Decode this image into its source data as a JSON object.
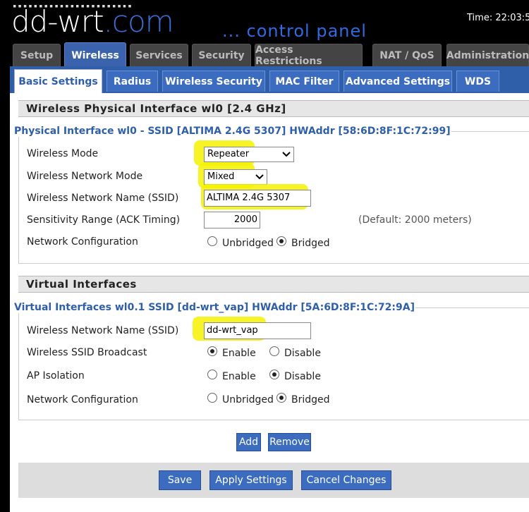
{
  "header": {
    "logo_text": "dd-wrt",
    "logo_suffix": ".com",
    "subtitle": "... control panel",
    "time": "Time: 22:03:5"
  },
  "main_tabs": [
    "Setup",
    "Wireless",
    "Services",
    "Security",
    "Access Restrictions",
    "NAT / QoS",
    "Administration"
  ],
  "sub_tabs": [
    "Basic Settings",
    "Radius",
    "Wireless Security",
    "MAC Filter",
    "Advanced Settings",
    "WDS"
  ],
  "physical": {
    "section_title": "Wireless Physical Interface wl0 [2.4 GHz]",
    "legend": "Physical Interface wl0 - SSID [ALTIMA 2.4G 5307] HWAddr [58:6D:8F:1C:72:99]",
    "wireless_mode": {
      "label": "Wireless Mode",
      "value": "Repeater"
    },
    "network_mode": {
      "label": "Wireless Network Mode",
      "value": "Mixed"
    },
    "ssid": {
      "label": "Wireless Network Name (SSID)",
      "value": "ALTIMA 2.4G 5307"
    },
    "sensitivity": {
      "label": "Sensitivity Range (ACK Timing)",
      "value": "2000",
      "hint": "(Default: 2000 meters)"
    },
    "netconfig": {
      "label": "Network Configuration",
      "options": [
        "Unbridged",
        "Bridged"
      ],
      "selected": "Bridged"
    }
  },
  "virtual": {
    "section_title": "Virtual Interfaces",
    "legend": "Virtual Interfaces wl0.1 SSID [dd-wrt_vap] HWAddr [5A:6D:8F:1C:72:9A]",
    "ssid": {
      "label": "Wireless Network Name (SSID)",
      "value": "dd-wrt_vap"
    },
    "broadcast": {
      "label": "Wireless SSID Broadcast",
      "options": [
        "Enable",
        "Disable"
      ],
      "selected": "Enable"
    },
    "ap_isolation": {
      "label": "AP Isolation",
      "options": [
        "Enable",
        "Disable"
      ],
      "selected": "Disable"
    },
    "netconfig": {
      "label": "Network Configuration",
      "options": [
        "Unbridged",
        "Bridged"
      ],
      "selected": "Bridged"
    },
    "add_label": "Add",
    "remove_label": "Remove"
  },
  "footer": {
    "save_label": "Save",
    "apply_label": "Apply Settings",
    "cancel_label": "Cancel Changes"
  },
  "colors": {
    "accent": "#3b63ad",
    "highlight": "#f5f200",
    "legend_text": "#2f5fa8"
  }
}
